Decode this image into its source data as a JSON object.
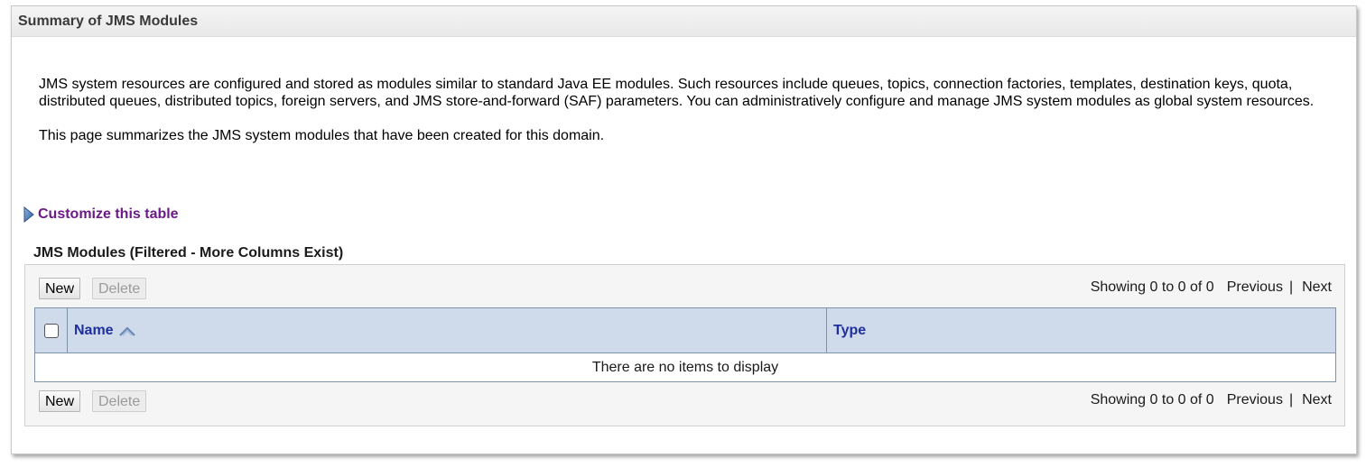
{
  "panel": {
    "title": "Summary of JMS Modules"
  },
  "intro": {
    "paragraph1": "JMS system resources are configured and stored as modules similar to standard Java EE modules. Such resources include queues, topics, connection factories, templates, destination keys, quota, distributed queues, distributed topics, foreign servers, and JMS store-and-forward (SAF) parameters. You can administratively configure and manage JMS system modules as global system resources.",
    "paragraph2": "This page summarizes the JMS system modules that have been created for this domain."
  },
  "customize": {
    "label": "Customize this table",
    "icon": "expand-triangle-icon"
  },
  "table": {
    "title": "JMS Modules (Filtered - More Columns Exist)",
    "top_actions": {
      "new_label": "New",
      "delete_label": "Delete"
    },
    "bottom_actions": {
      "new_label": "New",
      "delete_label": "Delete"
    },
    "pager_top": {
      "showing": "Showing 0 to 0 of 0",
      "previous": "Previous",
      "separator": "|",
      "next": "Next"
    },
    "pager_bottom": {
      "showing": "Showing 0 to 0 of 0",
      "previous": "Previous",
      "separator": "|",
      "next": "Next"
    },
    "columns": [
      {
        "label": "Name",
        "sort_icon": "sort-ascending-icon"
      },
      {
        "label": "Type"
      }
    ],
    "empty_message": "There are no items to display"
  },
  "colors": {
    "header_bg": "#cfdbea",
    "link_purple": "#6b1a86",
    "column_link": "#1f2f9e",
    "grid_border": "#7f93a8"
  }
}
